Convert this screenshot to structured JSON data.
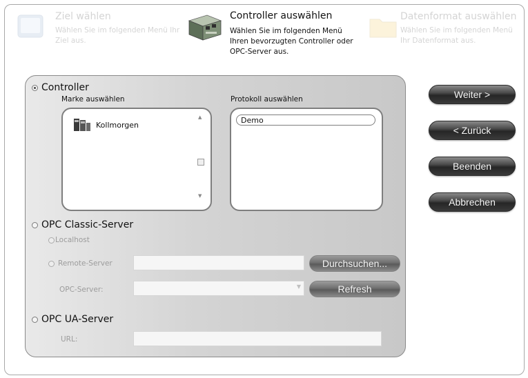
{
  "steps": [
    {
      "title": "Ziel wählen",
      "desc": "Wählen Sie im folgenden Menü Ihr Ziel aus."
    },
    {
      "title": "Controller auswählen",
      "desc": "Wählen Sie im folgenden Menü Ihren bevorzugten Controller oder OPC-Server aus."
    },
    {
      "title": "Datenformat auswählen",
      "desc": "Wählen Sie im folgenden Menü Ihr Datenformat aus."
    }
  ],
  "controller": {
    "label": "Controller",
    "brand_label": "Marke auswählen",
    "protocol_label": "Protokoll auswählen",
    "brands": [
      "Kollmorgen"
    ],
    "protocols": [
      "Demo"
    ]
  },
  "opc_classic": {
    "label": "OPC Classic-Server",
    "localhost_label": "Localhost",
    "remote_label": "Remote-Server",
    "browse_button": "Durchsuchen...",
    "server_label": "OPC-Server:",
    "refresh_button": "Refresh"
  },
  "opc_ua": {
    "label": "OPC UA-Server",
    "url_label": "URL:"
  },
  "buttons": {
    "next": "Weiter >",
    "back": "< Zurück",
    "finish": "Beenden",
    "cancel": "Abbrechen"
  }
}
